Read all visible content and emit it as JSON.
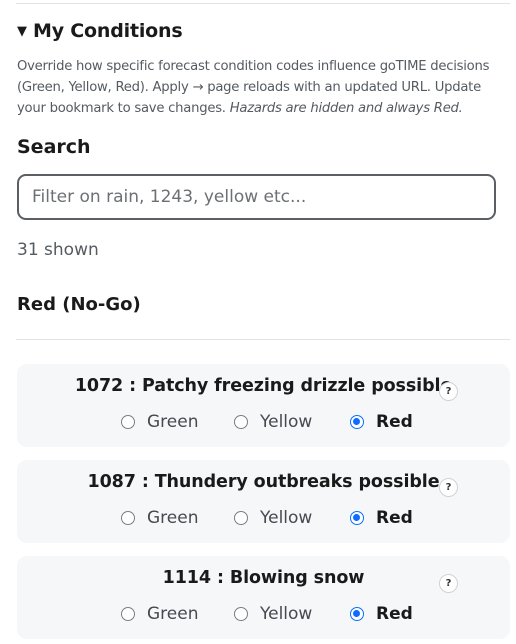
{
  "panel": {
    "toggle_glyph": "▼",
    "title": "My Conditions",
    "description_main": "Override how specific forecast condition codes influence goTIME decisions (Green, Yellow, Red). Apply → page reloads with an updated URL. Update your bookmark to save changes. ",
    "description_em": "Hazards are hidden and always Red."
  },
  "search": {
    "label": "Search",
    "placeholder": "Filter on rain, 1243, yellow etc...",
    "value": ""
  },
  "results": {
    "count_text": "31 shown"
  },
  "group": {
    "heading": "Red (No-Go)"
  },
  "options": {
    "green": "Green",
    "yellow": "Yellow",
    "red": "Red"
  },
  "conditions": [
    {
      "title": "1072 : Patchy freezing drizzle possible",
      "help": "?",
      "selected": "Red"
    },
    {
      "title": "1087 : Thundery outbreaks possible",
      "help": "?",
      "selected": "Red"
    },
    {
      "title": "1114 : Blowing snow",
      "help": "?",
      "selected": "Red"
    }
  ],
  "colors": {
    "accent": "#0d6efd",
    "card_bg": "#f6f7f8",
    "muted_text": "#555b61"
  },
  "icons": {
    "toggle": "caret-down-icon",
    "help": "question-circle-icon",
    "radio_selected": "radio-checked-icon",
    "radio_unselected": "radio-unchecked-icon"
  }
}
